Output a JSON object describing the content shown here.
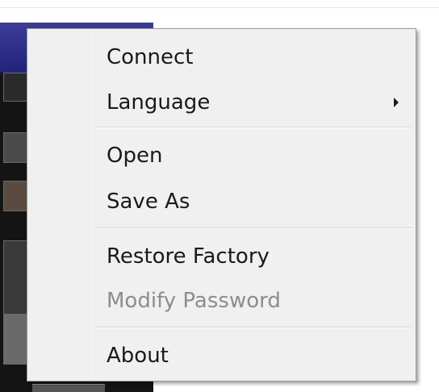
{
  "menu": {
    "items": [
      {
        "label": "Connect",
        "enabled": true
      },
      {
        "label": "Language",
        "enabled": true,
        "submenu": true
      },
      {
        "label": "Open",
        "enabled": true
      },
      {
        "label": "Save As",
        "enabled": true
      },
      {
        "label": "Restore Factory",
        "enabled": true
      },
      {
        "label": "Modify Password",
        "enabled": false
      },
      {
        "label": "About",
        "enabled": true
      }
    ]
  },
  "colors": {
    "menu_background": "#f0f0f0",
    "menu_border": "#979797",
    "text_enabled": "#1a1a1a",
    "text_disabled": "#8d8d8d",
    "titlebar_blue": "#2a2a85"
  }
}
